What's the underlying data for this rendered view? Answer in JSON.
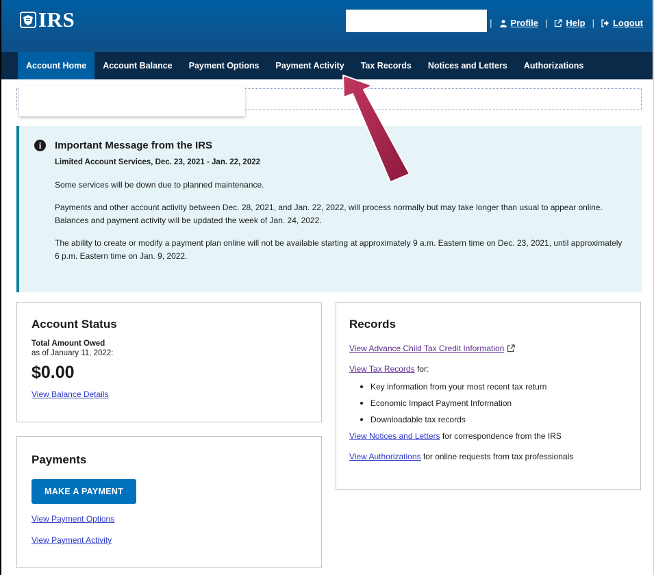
{
  "header": {
    "logo_text": "IRS",
    "links": [
      {
        "label": "Profile",
        "icon": "user-icon"
      },
      {
        "label": "Help",
        "icon": "external-link-icon"
      },
      {
        "label": "Logout",
        "icon": "logout-icon"
      }
    ],
    "separator": "|"
  },
  "nav": {
    "items": [
      {
        "label": "Account Home",
        "active": true
      },
      {
        "label": "Account Balance"
      },
      {
        "label": "Payment Options"
      },
      {
        "label": "Payment Activity"
      },
      {
        "label": "Tax Records"
      },
      {
        "label": "Notices and Letters"
      },
      {
        "label": "Authorizations"
      }
    ]
  },
  "alert": {
    "icon": "info-icon",
    "title": "Important Message from the IRS",
    "subtitle": "Limited Account Services, Dec. 23, 2021 - Jan. 22, 2022",
    "paragraphs": [
      "Some services will be down due to planned maintenance.",
      "Payments and other account activity between Dec. 28, 2021, and Jan. 22, 2022, will process normally but may take longer than usual to appear online. Balances and payment activity will be updated the week of Jan. 24, 2022.",
      "The ability to create or modify a payment plan online will not be available starting at approximately 9 a.m. Eastern time on Dec. 23, 2021, until approximately 6 p.m. Eastern time on Jan. 9, 2022."
    ]
  },
  "account_status": {
    "title": "Account Status",
    "total_label": "Total Amount Owed",
    "as_of": "as of January 11, 2022:",
    "amount": "$0.00",
    "link": "View Balance Details"
  },
  "payments": {
    "title": "Payments",
    "button": "MAKE A PAYMENT",
    "links": [
      "View Payment Options",
      "View Payment Activity"
    ]
  },
  "records": {
    "title": "Records",
    "child_credit_link": "View Advance Child Tax Credit Information",
    "tax_records_link": "View Tax Records",
    "tax_records_suffix": " for:",
    "bullets": [
      "Key information from your most recent tax return",
      "Economic Impact Payment Information",
      "Downloadable tax records"
    ],
    "notices_link": "View Notices and Letters",
    "notices_suffix": " for correspondence from the IRS",
    "auth_link": "View Authorizations",
    "auth_suffix": " for online requests from tax professionals"
  },
  "colors": {
    "header": "#005ea2",
    "nav": "#0a2a4a",
    "alert_bg": "#e6f4f7",
    "alert_border": "#00809a",
    "button": "#0071bc",
    "arrow": "#a8204a"
  }
}
